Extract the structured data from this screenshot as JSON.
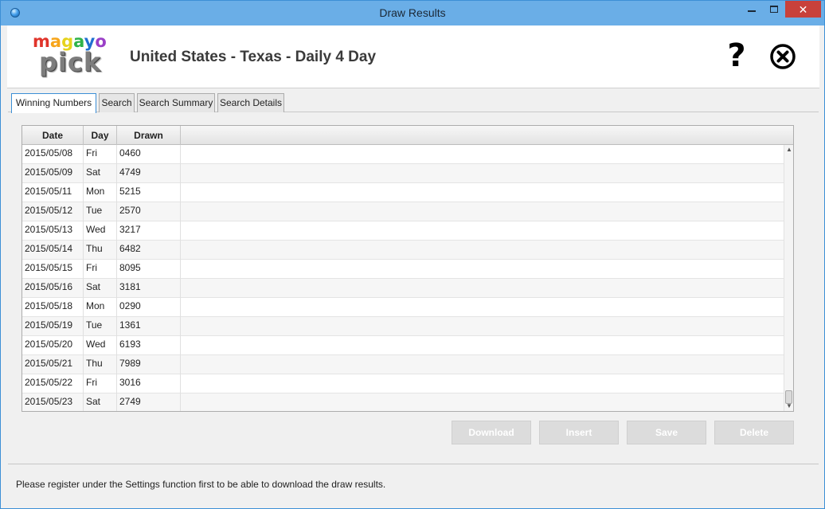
{
  "window": {
    "title": "Draw Results",
    "minimize_glyph": "",
    "close_glyph": "✕"
  },
  "logo": {
    "top_text": "magayo",
    "bottom_text": "pick",
    "top_letter_colors": [
      "#e0342b",
      "#f7a51a",
      "#e6d31c",
      "#2fb24a",
      "#1f6fd1",
      "#9a3fc7"
    ]
  },
  "header": {
    "title": "United States - Texas - Daily 4 Day",
    "help_glyph": "?"
  },
  "tabs": [
    {
      "label": "Winning Numbers",
      "active": true
    },
    {
      "label": "Search",
      "active": false
    },
    {
      "label": "Search Summary",
      "active": false
    },
    {
      "label": "Search Details",
      "active": false
    }
  ],
  "table": {
    "columns": [
      "Date",
      "Day",
      "Drawn"
    ],
    "rows": [
      [
        "2015/05/08",
        "Fri",
        "0460"
      ],
      [
        "2015/05/09",
        "Sat",
        "4749"
      ],
      [
        "2015/05/11",
        "Mon",
        "5215"
      ],
      [
        "2015/05/12",
        "Tue",
        "2570"
      ],
      [
        "2015/05/13",
        "Wed",
        "3217"
      ],
      [
        "2015/05/14",
        "Thu",
        "6482"
      ],
      [
        "2015/05/15",
        "Fri",
        "8095"
      ],
      [
        "2015/05/16",
        "Sat",
        "3181"
      ],
      [
        "2015/05/18",
        "Mon",
        "0290"
      ],
      [
        "2015/05/19",
        "Tue",
        "1361"
      ],
      [
        "2015/05/20",
        "Wed",
        "6193"
      ],
      [
        "2015/05/21",
        "Thu",
        "7989"
      ],
      [
        "2015/05/22",
        "Fri",
        "3016"
      ],
      [
        "2015/05/23",
        "Sat",
        "2749"
      ]
    ]
  },
  "actions": {
    "download": "Download",
    "insert": "Insert",
    "save": "Save",
    "delete": "Delete"
  },
  "status": {
    "message": "Please register under the Settings function first to be able to download the draw results."
  },
  "colors": {
    "titlebar": "#6aaee7",
    "close_button": "#c8413b",
    "active_tab_border": "#3c8fd6",
    "disabled_button": "#dcdcdc"
  }
}
